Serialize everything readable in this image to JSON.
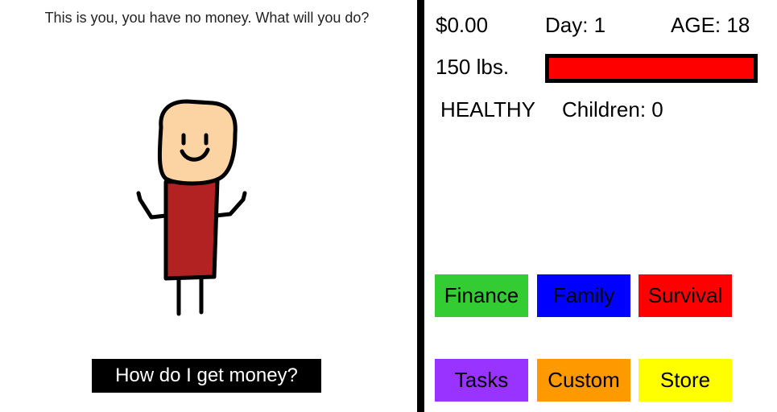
{
  "scene": {
    "narration": "This is you, you have no money. What will you do?",
    "action_button": "How do I get money?",
    "character_colors": {
      "skin": "#fcd4a4",
      "shirt": "#b22222",
      "outline": "#000000"
    }
  },
  "stats": {
    "money": "$0.00",
    "day": "Day: 1",
    "age": "AGE: 18",
    "weight": "150 lbs.",
    "health_fraction": 1.0,
    "health_color": "#ff0000",
    "status": "HEALTHY",
    "children": "Children: 0"
  },
  "menu": {
    "buttons": [
      {
        "label": "Finance",
        "color": "#33cc33"
      },
      {
        "label": "Family",
        "color": "#0000ff"
      },
      {
        "label": "Survival",
        "color": "#ff0000"
      },
      {
        "label": "Tasks",
        "color": "#9933ff"
      },
      {
        "label": "Custom",
        "color": "#ff9900"
      },
      {
        "label": "Store",
        "color": "#ffff00"
      }
    ]
  }
}
